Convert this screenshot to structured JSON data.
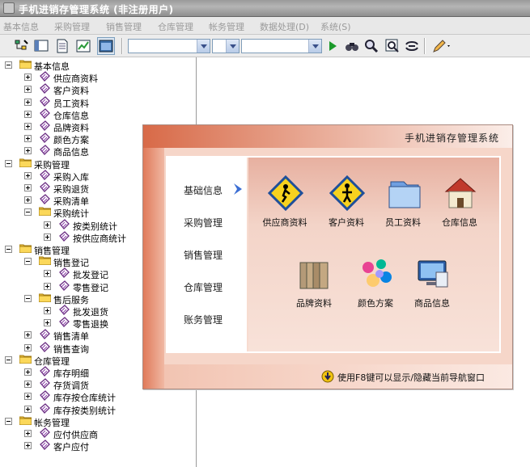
{
  "window": {
    "title": "手机进销存管理系统 (非注册用户)"
  },
  "menu": [
    "基本信息",
    "采购管理",
    "销售管理",
    "仓库管理",
    "帐务管理",
    "数据处理(D)",
    "系统(S)"
  ],
  "toolbar": {
    "combo1": "",
    "combo2": "",
    "combo3": ""
  },
  "tree": {
    "groups": [
      {
        "label": "基本信息",
        "items": [
          "供应商资料",
          "客户资料",
          "员工资料",
          "仓库信息",
          "品牌资料",
          "颜色方案",
          "商品信息"
        ]
      },
      {
        "label": "采购管理",
        "items": [
          "采购入库",
          "采购退货",
          "采购清单"
        ],
        "sub": {
          "label": "采购统计",
          "items": [
            "按类别统计",
            "按供应商统计"
          ]
        }
      },
      {
        "label": "销售管理",
        "sub1": {
          "label": "销售登记",
          "items": [
            "批发登记",
            "零售登记"
          ]
        },
        "sub2": {
          "label": "售后服务",
          "items": [
            "批发退货",
            "零售退换"
          ]
        },
        "items": [
          "销售清单",
          "销售查询"
        ]
      },
      {
        "label": "仓库管理",
        "items": [
          "库存明细",
          "存货调货",
          "库存按仓库统计",
          "库存按类别统计"
        ]
      },
      {
        "label": "帐务管理",
        "items": [
          "应付供应商",
          "客户应付"
        ]
      }
    ]
  },
  "nav": {
    "title": "手机进销存管理系统",
    "categories": [
      "基础信息",
      "采购管理",
      "销售管理",
      "仓库管理",
      "账务管理"
    ],
    "tiles": [
      "供应商资料",
      "客户资料",
      "员工资料",
      "仓库信息",
      "品牌资料",
      "颜色方案",
      "商品信息"
    ],
    "tip": "使用F8键可以显示/隐藏当前导航窗口"
  }
}
